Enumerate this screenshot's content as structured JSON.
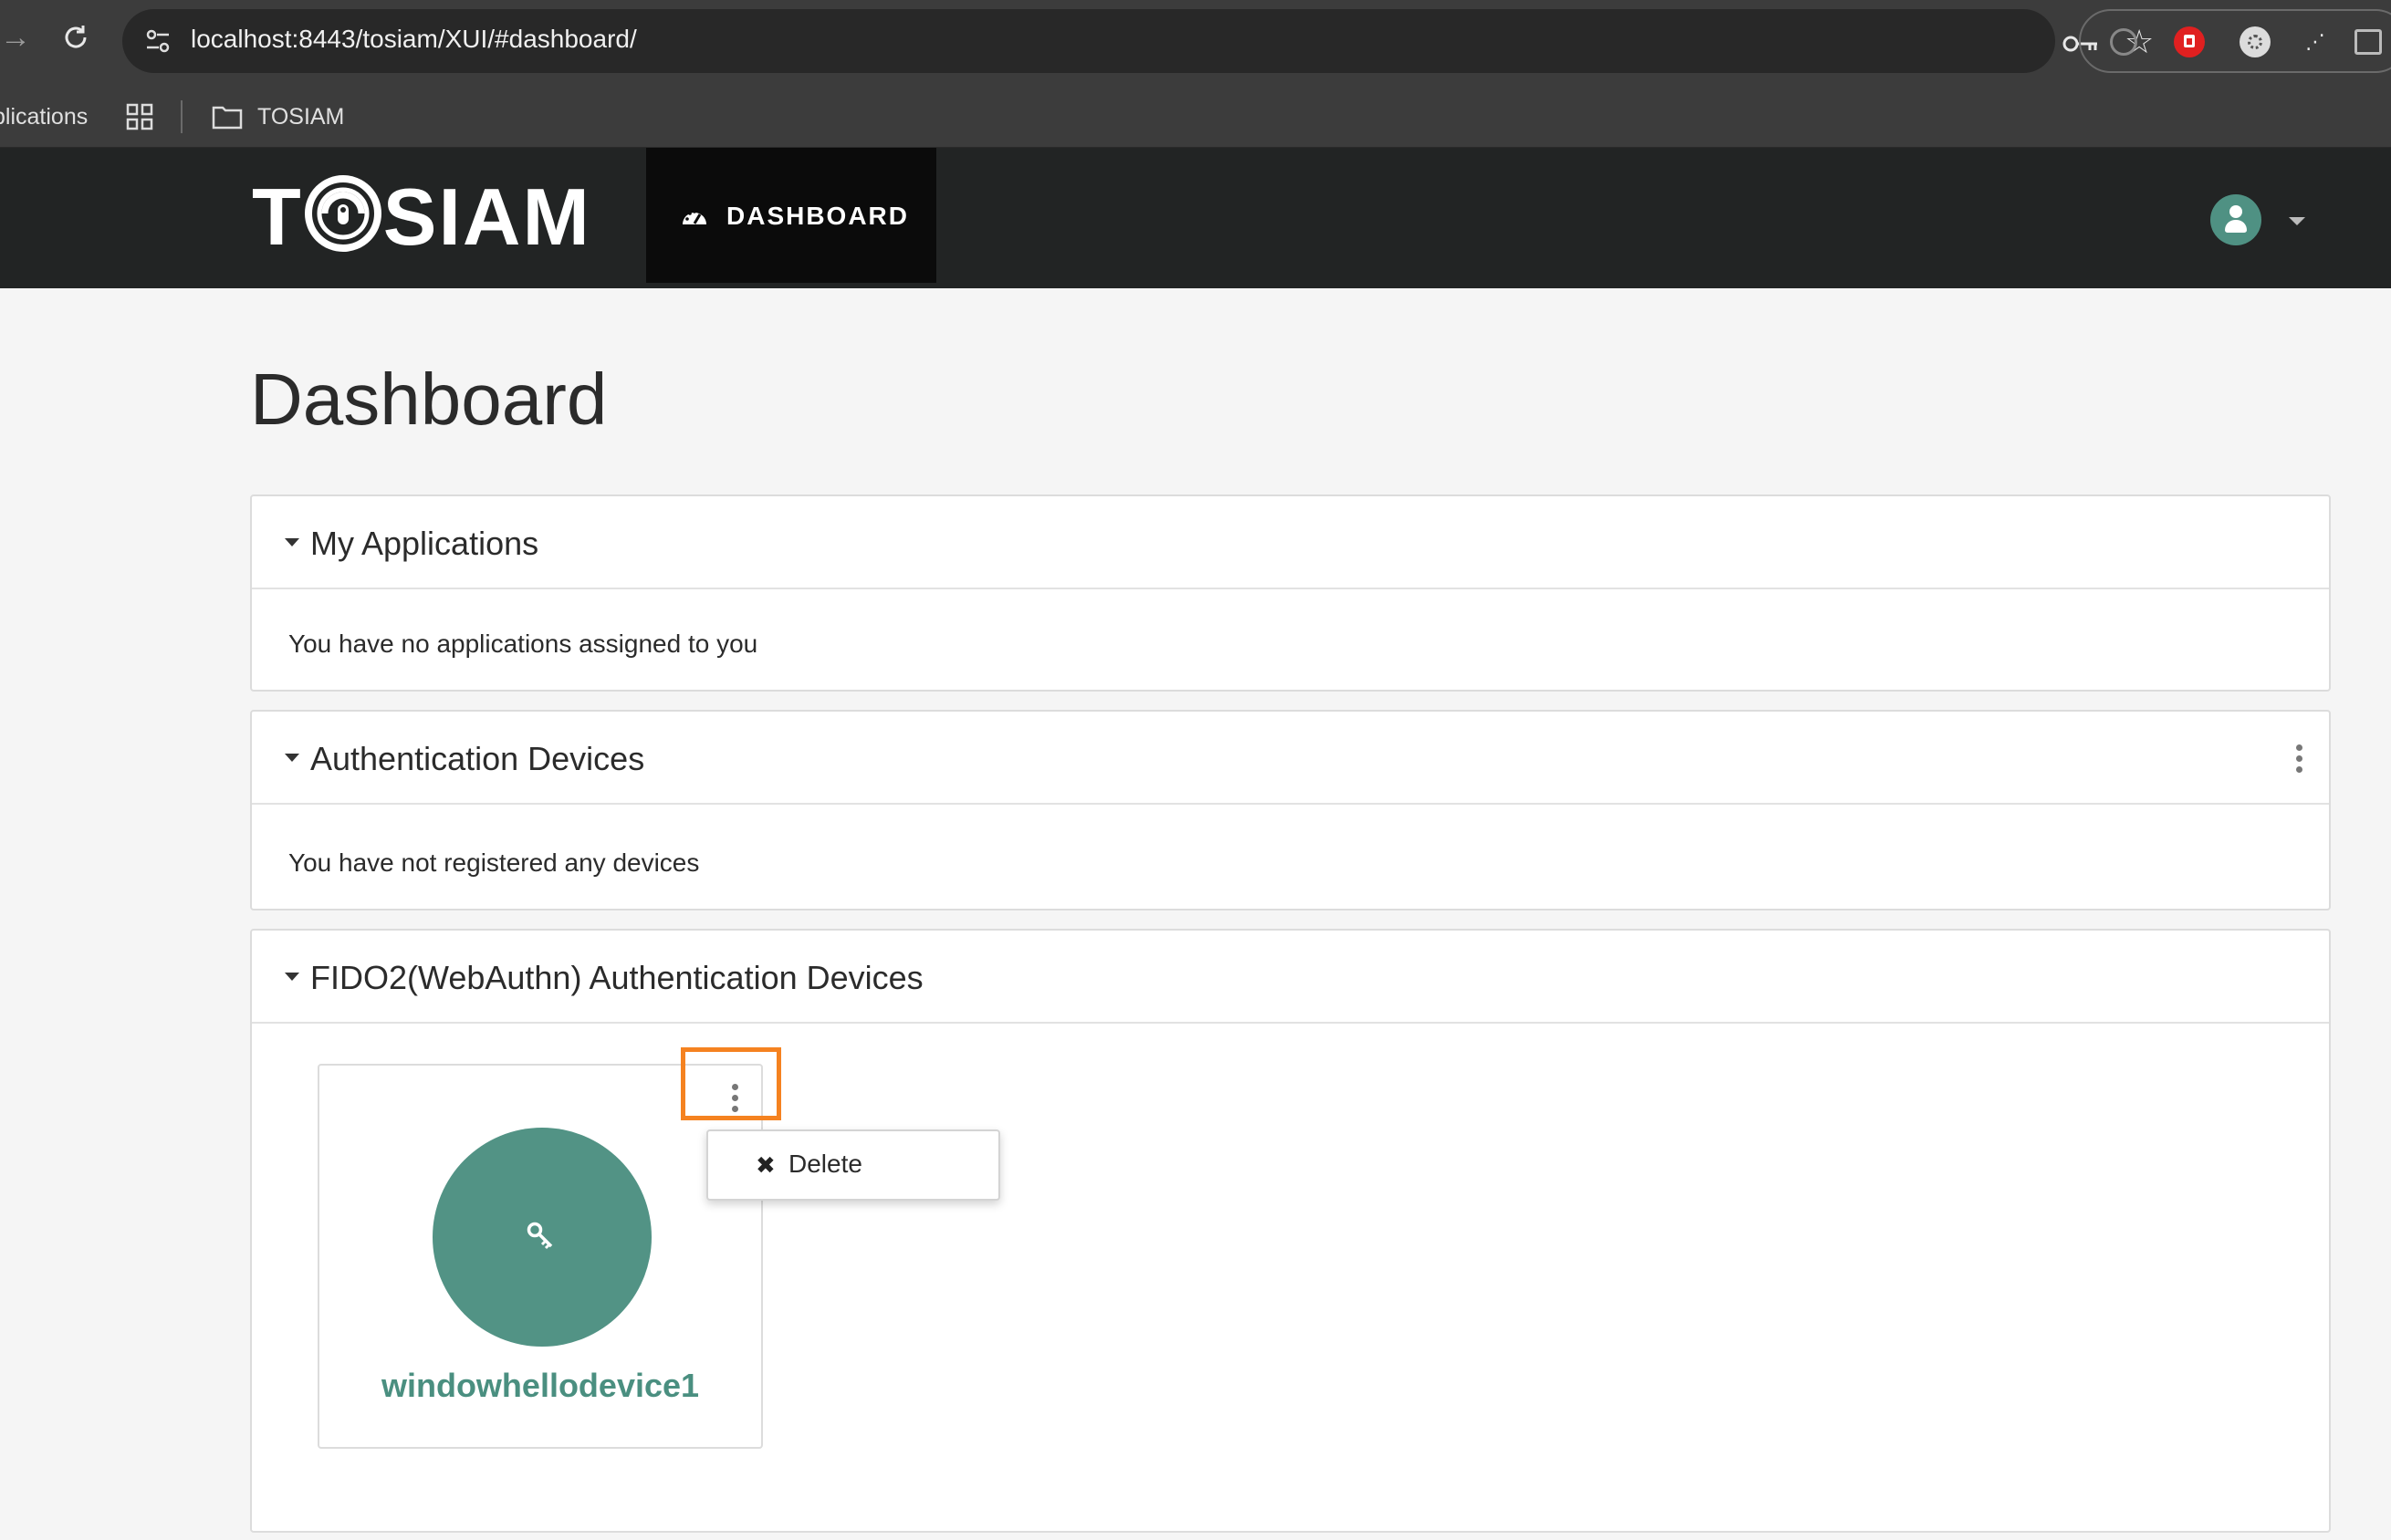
{
  "browser": {
    "url": "localhost:8443/tosiam/XUI/#dashboard/",
    "bookmarks": {
      "apps_label": "plications",
      "folder_label": "TOSIAM"
    }
  },
  "navbar": {
    "logo_left": "T",
    "logo_right": "SIAM",
    "dashboard_tab": "DASHBOARD"
  },
  "page": {
    "title": "Dashboard"
  },
  "panels": {
    "applications": {
      "title": "My Applications",
      "empty_text": "You have no applications assigned to you"
    },
    "auth_devices": {
      "title": "Authentication Devices",
      "empty_text": "You have not registered any devices"
    },
    "fido_devices": {
      "title": "FIDO2(WebAuthn) Authentication Devices",
      "devices": [
        {
          "name": "windowhellodevice1",
          "icon": "key-icon"
        }
      ],
      "menu": {
        "delete_label": "Delete"
      }
    }
  },
  "colors": {
    "brand_teal": "#529385",
    "highlight_orange": "#f58220",
    "navbar_bg": "#222424"
  }
}
